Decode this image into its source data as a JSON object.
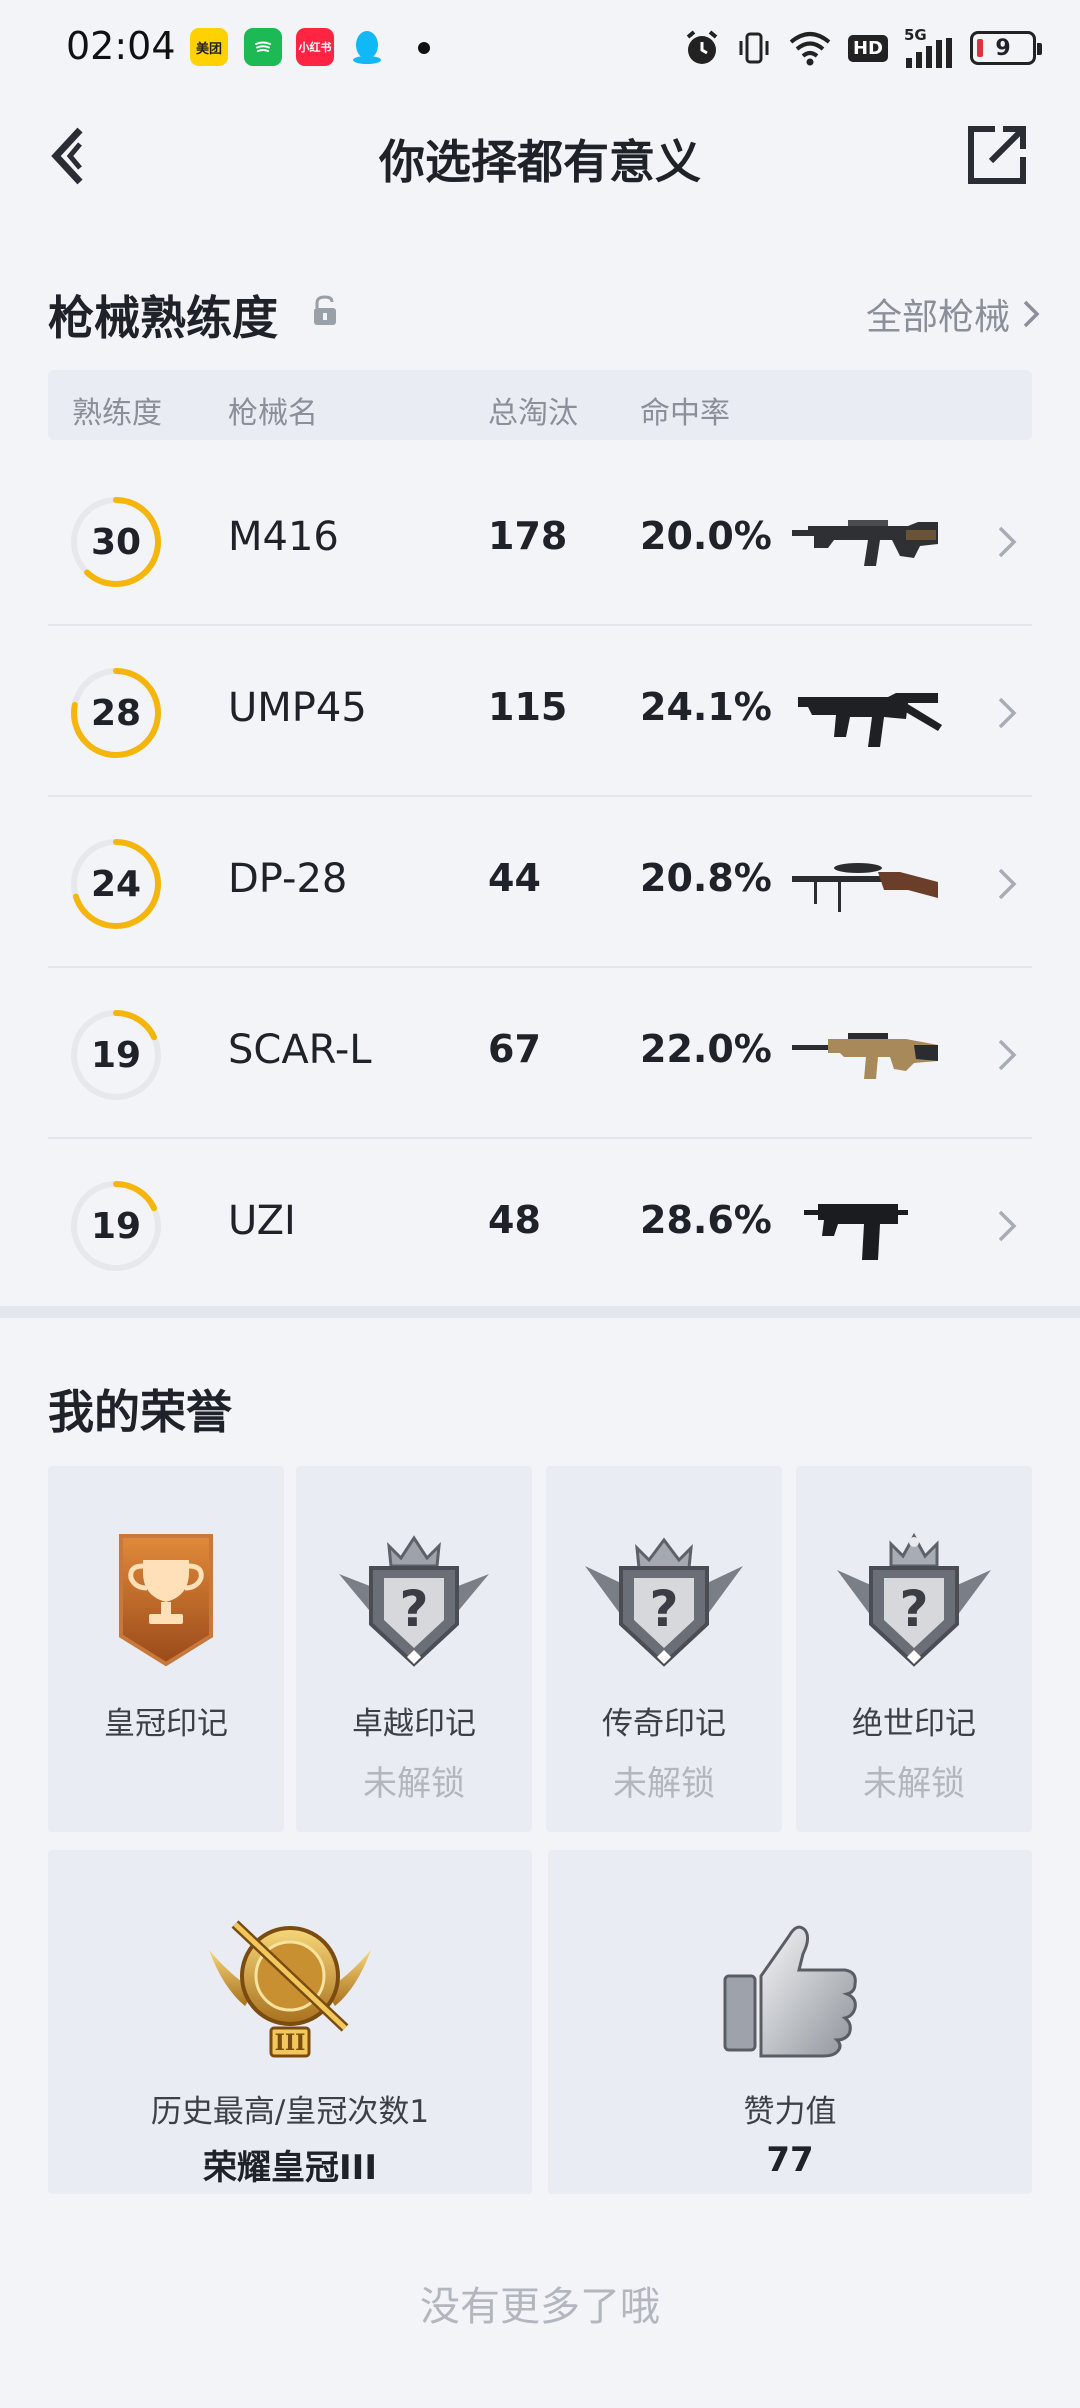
{
  "status_bar": {
    "time": "02:04",
    "apps": [
      {
        "name": "meituan-app-icon",
        "label": "美团",
        "color": "#ffd100",
        "text_color": "#222"
      },
      {
        "name": "spotify-app-icon",
        "label": "",
        "color": "#1db954",
        "text_color": "#fff"
      },
      {
        "name": "xiaohongshu-app-icon",
        "label": "小红书",
        "color": "#ff2442",
        "text_color": "#fff"
      },
      {
        "name": "qq-app-icon",
        "label": "",
        "color": "#12b7f5",
        "text_color": "#fff"
      }
    ],
    "network": "5G",
    "hd": "HD",
    "battery": "9"
  },
  "header": {
    "title": "你选择都有意义"
  },
  "weapons": {
    "section_title": "枪械熟练度",
    "all_link": "全部枪械",
    "columns": [
      "熟练度",
      "枪械名",
      "总淘汰",
      "命中率"
    ],
    "rows": [
      {
        "level": "30",
        "progress": 0.62,
        "name": "M416",
        "kills": "178",
        "rate": "20.0%",
        "weapon": "m416"
      },
      {
        "level": "28",
        "progress": 0.78,
        "name": "UMP45",
        "kills": "115",
        "rate": "24.1%",
        "weapon": "ump45"
      },
      {
        "level": "24",
        "progress": 0.7,
        "name": "DP-28",
        "kills": "44",
        "rate": "20.8%",
        "weapon": "dp28"
      },
      {
        "level": "19",
        "progress": 0.18,
        "name": "SCAR-L",
        "kills": "67",
        "rate": "22.0%",
        "weapon": "scarl"
      },
      {
        "level": "19",
        "progress": 0.18,
        "name": "UZI",
        "kills": "48",
        "rate": "28.6%",
        "weapon": "uzi"
      }
    ]
  },
  "honors": {
    "section_title": "我的荣誉",
    "badges": [
      {
        "name": "皇冠印记",
        "status": "",
        "unlocked": true
      },
      {
        "name": "卓越印记",
        "status": "未解锁",
        "unlocked": false
      },
      {
        "name": "传奇印记",
        "status": "未解锁",
        "unlocked": false
      },
      {
        "name": "绝世印记",
        "status": "未解锁",
        "unlocked": false
      }
    ],
    "best_rank": {
      "label": "历史最高/皇冠次数1",
      "value": "荣耀皇冠III",
      "roman": "III"
    },
    "likes": {
      "label": "赞力值",
      "value": "77"
    }
  },
  "footer": "没有更多了哦",
  "colors": {
    "accent_ring": "#f5b50a",
    "ring_track": "#e6e8ec",
    "gold": "#c9922e"
  }
}
